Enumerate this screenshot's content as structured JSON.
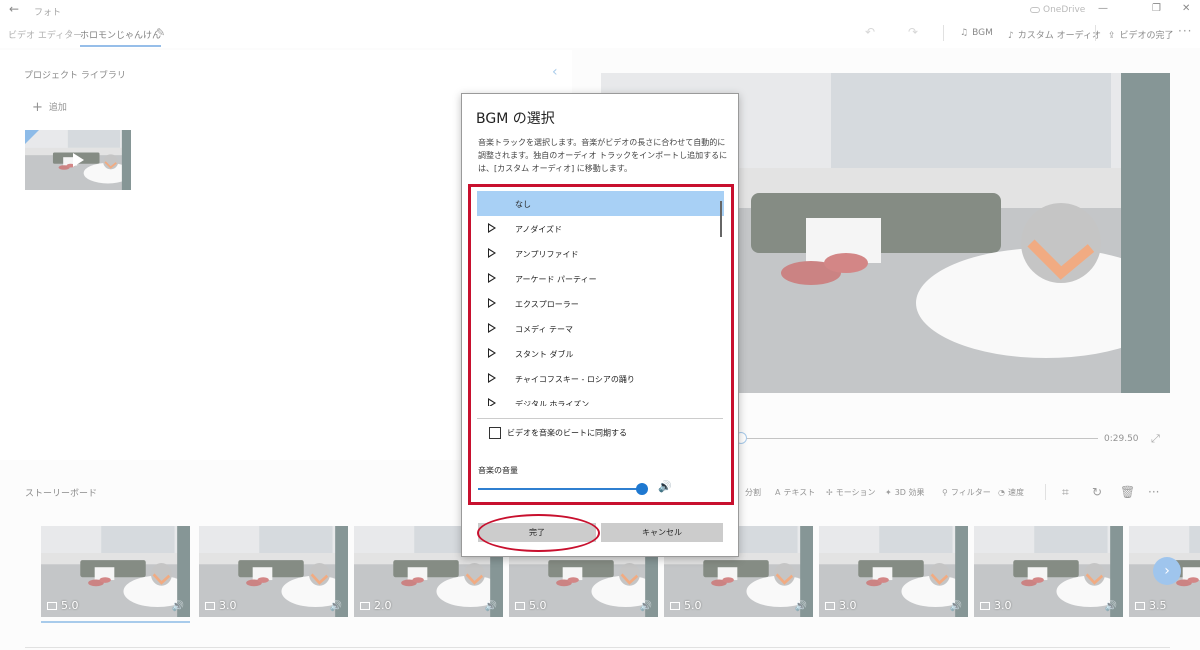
{
  "titlebar": {
    "app_title": "フォト",
    "onedrive_label": "OneDrive"
  },
  "cmdbar": {
    "breadcrumb_root": "ビデオ エディター",
    "project_name": "ホロモンじゃんけん",
    "bgm_label": "BGM",
    "custom_audio_label": "カスタム オーディオ",
    "finish_video_label": "ビデオの完了"
  },
  "library": {
    "title": "プロジェクト ライブラリ",
    "add_label": "追加"
  },
  "preview": {
    "time_end": "0:29.50"
  },
  "storyboard": {
    "title": "ストーリーボード",
    "tools": {
      "split": "分割",
      "text": "テキスト",
      "motion": "モーション",
      "effects_3d": "3D 効果",
      "filter": "フィルター",
      "speed": "速度"
    },
    "clips": [
      {
        "duration": "5.0"
      },
      {
        "duration": "3.0"
      },
      {
        "duration": "2.0"
      },
      {
        "duration": "5.0"
      },
      {
        "duration": "5.0"
      },
      {
        "duration": "3.0"
      },
      {
        "duration": "3.0"
      },
      {
        "duration": "3.5"
      }
    ]
  },
  "dialog": {
    "title": "BGM の選択",
    "description": "音楽トラックを選択します。音楽がビデオの長さに合わせて自動的に調整されます。独自のオーディオ トラックをインポートし追加するには、[カスタム オーディオ] に移動します。",
    "tracks": [
      {
        "label": "なし",
        "selected": true
      },
      {
        "label": "アノダイズド"
      },
      {
        "label": "アンプリファイド"
      },
      {
        "label": "アーケード パーティー"
      },
      {
        "label": "エクスプローラー"
      },
      {
        "label": "コメディ テーマ"
      },
      {
        "label": "スタント ダブル"
      },
      {
        "label": "チャイコフスキー - ロシアの踊り"
      },
      {
        "label": "デジタル ホライズン"
      }
    ],
    "sync_label": "ビデオを音楽のビートに同期する",
    "sync_checked": false,
    "volume_label": "音楽の音量",
    "volume_level": 1.0,
    "done_button": "完了",
    "cancel_button": "キャンセル"
  },
  "colors": {
    "accent": "#1e78d0",
    "selection": "#a8d0f5",
    "highlight_annotation": "#c8102e"
  }
}
